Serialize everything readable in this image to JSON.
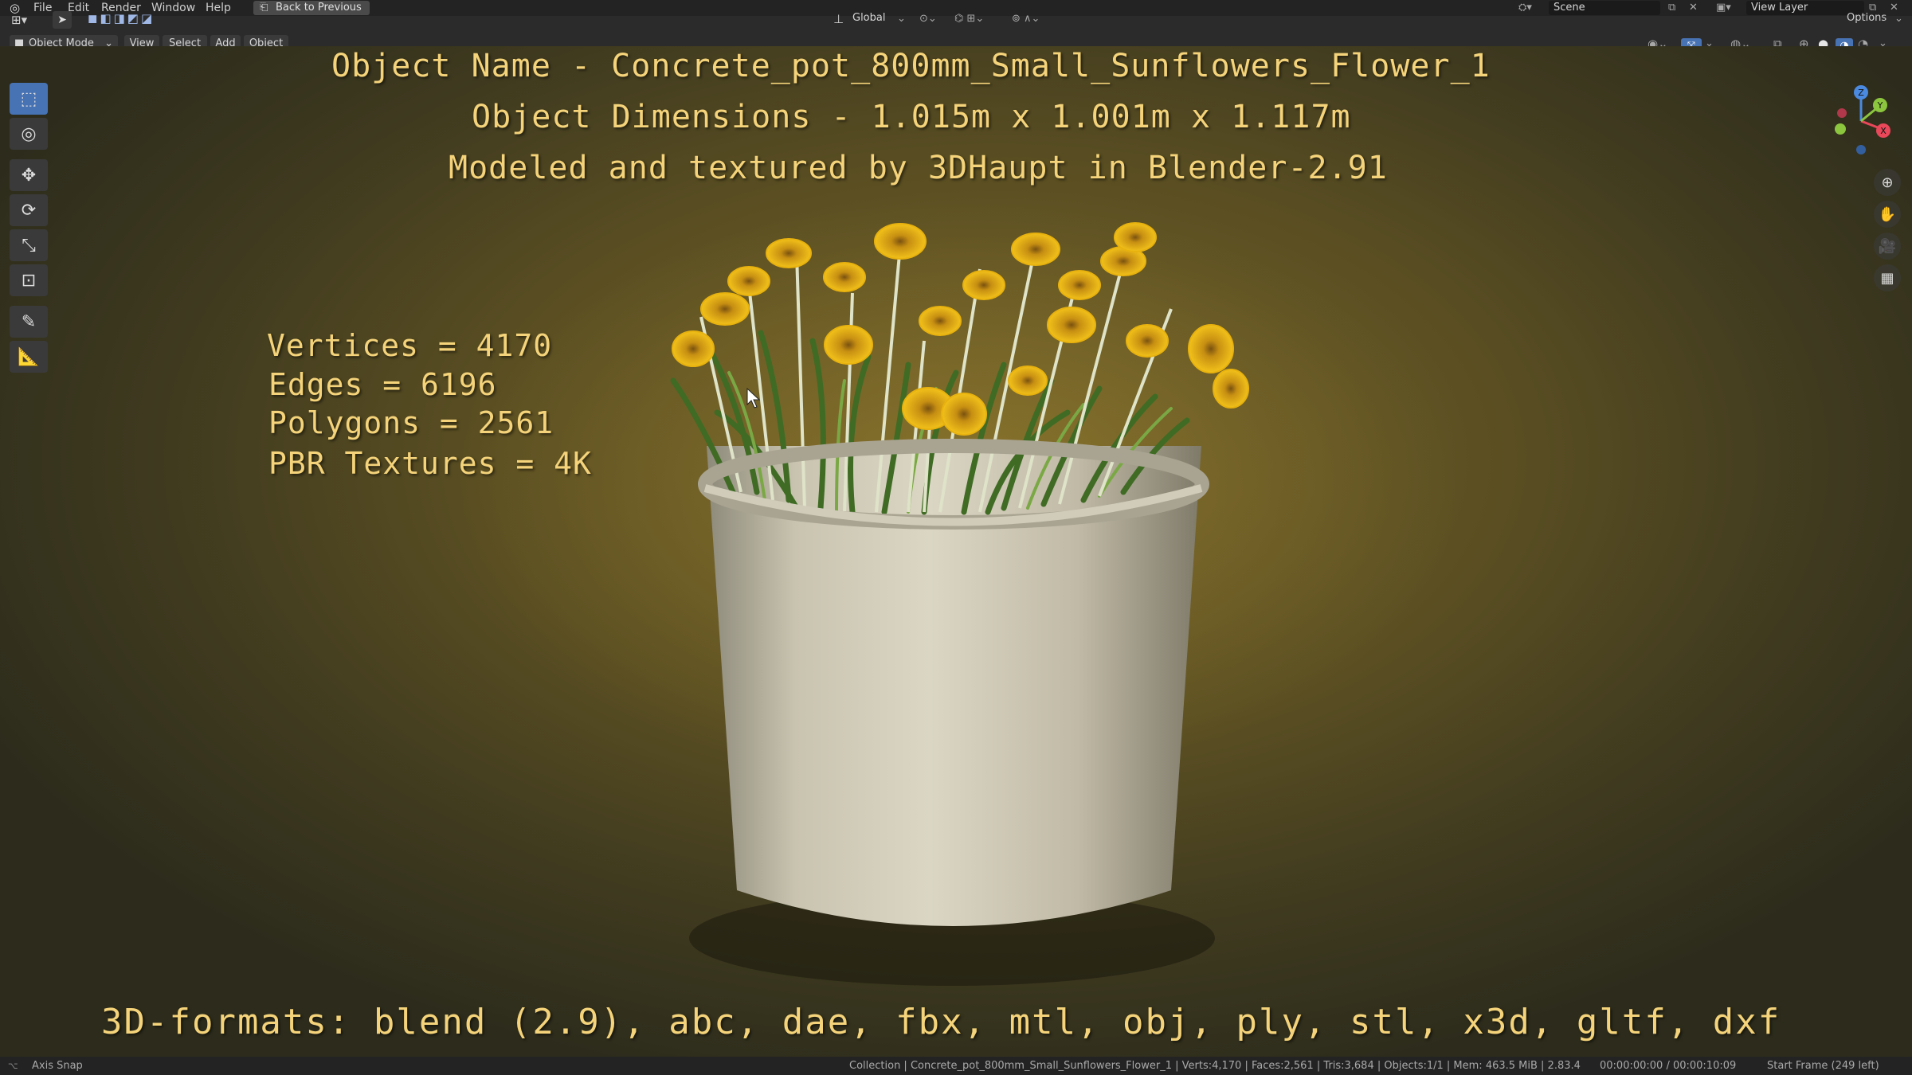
{
  "menubar": {
    "items": [
      "File",
      "Edit",
      "Render",
      "Window",
      "Help"
    ],
    "back_button": "Back to Previous",
    "scene_label": "Scene",
    "view_layer_label": "View Layer"
  },
  "header": {
    "mode": "Object Mode",
    "menus": [
      "View",
      "Select",
      "Add",
      "Object"
    ],
    "transform_orientation": "Global",
    "options_label": "Options"
  },
  "overlay": {
    "title_lines": [
      "Object Name - Concrete_pot_800mm_Small_Sunflowers_Flower_1",
      "Object Dimensions -  1.015m x 1.001m x 1.117m",
      "Modeled and textured by 3DHaupt in Blender-2.91"
    ],
    "stats": [
      "Vertices = 4170",
      "Edges = 6196",
      "Polygons = 2561",
      "PBR Textures = 4K"
    ],
    "formats": "3D-formats: blend (2.9), abc, dae, fbx, mtl, obj, ply, stl, x3d, gltf, dxf"
  },
  "gizmo": {
    "x_label": "X",
    "y_label": "Y",
    "z_label": "Z"
  },
  "statusbar": {
    "left_hint": "Axis Snap",
    "stats": "Collection | Concrete_pot_800mm_Small_Sunflowers_Flower_1 | Verts:4,170 | Faces:2,561 | Tris:3,684 | Objects:1/1 | Mem: 463.5 MiB | 2.83.4",
    "timecode": "00:00:00:00 / 00:00:10:09",
    "start_frame": "Start Frame (249 left)"
  },
  "icons": {
    "tools": [
      "select-box-icon",
      "cursor-icon",
      "move-icon",
      "rotate-icon",
      "scale-icon",
      "transform-icon",
      "annotate-icon",
      "measure-icon"
    ],
    "nav": [
      "zoom-icon",
      "pan-hand-icon",
      "camera-icon",
      "grid-icon"
    ]
  },
  "colors": {
    "overlay_text": "#f4d37a",
    "active_tool": "#4772b3",
    "axis_x": "#e8485a",
    "axis_y": "#8cc63f",
    "axis_z": "#4a8ae0"
  }
}
